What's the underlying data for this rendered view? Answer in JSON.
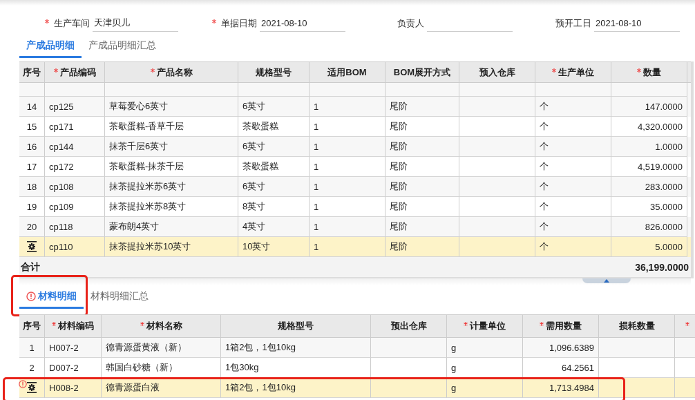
{
  "form": {
    "fields": [
      {
        "label": "生产车间",
        "required": true,
        "value": "天津贝儿"
      },
      {
        "label": "单据日期",
        "required": true,
        "value": "2021-08-10"
      },
      {
        "label": "负责人"
      },
      {
        "label": "预开工日",
        "value": "2021-08-10"
      }
    ]
  },
  "product_tabs": [
    {
      "label": "产成品明细",
      "selected": true
    },
    {
      "label": "产成品明细汇总",
      "selected": false
    }
  ],
  "product_table": {
    "columns": [
      {
        "label": "序号",
        "kind": "text"
      },
      {
        "label": "产品编码",
        "required": true,
        "kind": "text"
      },
      {
        "label": "产品名称",
        "required": true,
        "kind": "text"
      },
      {
        "label": "规格型号",
        "kind": "text"
      },
      {
        "label": "适用BOM",
        "kind": "text"
      },
      {
        "label": "BOM展开方式",
        "kind": "text"
      },
      {
        "label": "预入仓库",
        "kind": "text"
      },
      {
        "label": "生产单位",
        "required": true,
        "kind": "text"
      },
      {
        "label": "数量",
        "required": true,
        "kind": "number"
      }
    ],
    "rows": [
      {
        "selected": false,
        "cells": [
          "14",
          "cp125",
          "草莓爱心6英寸",
          "6英寸",
          "1",
          "尾阶",
          "",
          "个",
          "147.0000"
        ]
      },
      {
        "selected": false,
        "cells": [
          "15",
          "cp171",
          "茶歇蛋糕-香草千层",
          "茶歇蛋糕",
          "1",
          "尾阶",
          "",
          "个",
          "4,320.0000"
        ]
      },
      {
        "selected": false,
        "cells": [
          "16",
          "cp144",
          "抹茶千层6英寸",
          "6英寸",
          "1",
          "尾阶",
          "",
          "个",
          "1.0000"
        ]
      },
      {
        "selected": false,
        "cells": [
          "17",
          "cp172",
          "茶歇蛋糕-抹茶千层",
          "茶歇蛋糕",
          "1",
          "尾阶",
          "",
          "个",
          "4,519.0000"
        ]
      },
      {
        "selected": false,
        "cells": [
          "18",
          "cp108",
          "抹茶提拉米苏6英寸",
          "6英寸",
          "1",
          "尾阶",
          "",
          "个",
          "283.0000"
        ]
      },
      {
        "selected": false,
        "cells": [
          "19",
          "cp109",
          "抹茶提拉米苏8英寸",
          "8英寸",
          "1",
          "尾阶",
          "",
          "个",
          "35.0000"
        ]
      },
      {
        "selected": false,
        "cells": [
          "20",
          "cp118",
          "蒙布朗4英寸",
          "4英寸",
          "1",
          "尾阶",
          "",
          "个",
          "826.0000"
        ]
      },
      {
        "selected": true,
        "cells": [
          "",
          "cp110",
          "抹茶提拉米苏10英寸",
          "10英寸",
          "1",
          "尾阶",
          "",
          "个",
          "5.0000"
        ]
      }
    ],
    "total": {
      "label": "合计",
      "value": "36,199.0000"
    }
  },
  "material_tabs": [
    {
      "label": "材料明细",
      "selected": true,
      "error": true,
      "highlighted": true
    },
    {
      "label": "材料明细汇总",
      "selected": false
    }
  ],
  "material_table": {
    "columns": [
      {
        "label": "序号",
        "kind": "text"
      },
      {
        "label": "材料编码",
        "required": true,
        "kind": "text"
      },
      {
        "label": "材料名称",
        "required": true,
        "kind": "text"
      },
      {
        "label": "规格型号",
        "kind": "text"
      },
      {
        "label": "预出仓库",
        "kind": "text"
      },
      {
        "label": "计量单位",
        "required": true,
        "kind": "text"
      },
      {
        "label": "需用数量",
        "required": true,
        "kind": "number"
      },
      {
        "label": "损耗数量",
        "kind": "number"
      },
      {
        "required": true,
        "kind": "text"
      }
    ],
    "rows": [
      {
        "selected": false,
        "cells": [
          "1",
          "H007-2",
          "德青源蛋黄液（新）",
          "1箱2包，1包10kg",
          "",
          "g",
          "1,096.6389",
          "",
          ""
        ]
      },
      {
        "selected": false,
        "cells": [
          "2",
          "D007-2",
          "韩国白砂糖（新）",
          "1包30kg",
          "",
          "g",
          "64.2561",
          "",
          ""
        ]
      },
      {
        "selected": true,
        "error": true,
        "highlighted": true,
        "cells": [
          "",
          "H008-2",
          "德青源蛋白液",
          "1箱2包，1包10kg",
          "",
          "g",
          "1,713.4984",
          "",
          ""
        ]
      }
    ]
  }
}
